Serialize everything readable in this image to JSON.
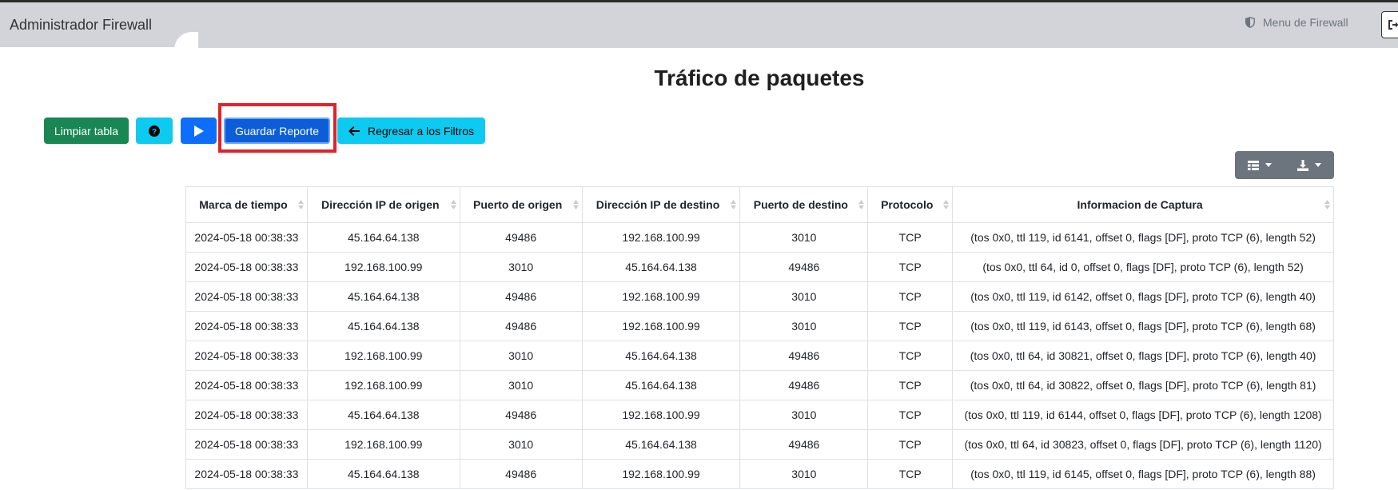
{
  "navbar": {
    "brand": "Administrador Firewall",
    "menu_label": "Menu de Firewall",
    "menu_icon": "shield-icon",
    "logout_icon": "logout-icon"
  },
  "page": {
    "title": "Tráfico de paquetes"
  },
  "toolbar": {
    "limpiar_label": "Limpiar tabla",
    "help_icon": "question-circle-icon",
    "play_icon": "play-icon",
    "guardar_label": "Guardar Reporte",
    "regresar_label": "Regresar a los Filtros",
    "regresar_icon": "arrow-left-icon"
  },
  "colors": {
    "success": "#198754",
    "info": "#0dcaf0",
    "primary": "#0d6efd",
    "highlight": "#e0232b",
    "secondary": "#6c757d"
  },
  "table": {
    "columns": [
      "Marca de tiempo",
      "Dirección IP de origen",
      "Puerto de origen",
      "Dirección IP de destino",
      "Puerto de destino",
      "Protocolo",
      "Informacion de Captura"
    ],
    "rows": [
      [
        "2024-05-18 00:38:33",
        "45.164.64.138",
        "49486",
        "192.168.100.99",
        "3010",
        "TCP",
        "(tos 0x0, ttl 119, id 6141, offset 0, flags [DF], proto TCP (6), length 52)"
      ],
      [
        "2024-05-18 00:38:33",
        "192.168.100.99",
        "3010",
        "45.164.64.138",
        "49486",
        "TCP",
        "(tos 0x0, ttl 64, id 0, offset 0, flags [DF], proto TCP (6), length 52)"
      ],
      [
        "2024-05-18 00:38:33",
        "45.164.64.138",
        "49486",
        "192.168.100.99",
        "3010",
        "TCP",
        "(tos 0x0, ttl 119, id 6142, offset 0, flags [DF], proto TCP (6), length 40)"
      ],
      [
        "2024-05-18 00:38:33",
        "45.164.64.138",
        "49486",
        "192.168.100.99",
        "3010",
        "TCP",
        "(tos 0x0, ttl 119, id 6143, offset 0, flags [DF], proto TCP (6), length 68)"
      ],
      [
        "2024-05-18 00:38:33",
        "192.168.100.99",
        "3010",
        "45.164.64.138",
        "49486",
        "TCP",
        "(tos 0x0, ttl 64, id 30821, offset 0, flags [DF], proto TCP (6), length 40)"
      ],
      [
        "2024-05-18 00:38:33",
        "192.168.100.99",
        "3010",
        "45.164.64.138",
        "49486",
        "TCP",
        "(tos 0x0, ttl 64, id 30822, offset 0, flags [DF], proto TCP (6), length 81)"
      ],
      [
        "2024-05-18 00:38:33",
        "45.164.64.138",
        "49486",
        "192.168.100.99",
        "3010",
        "TCP",
        "(tos 0x0, ttl 119, id 6144, offset 0, flags [DF], proto TCP (6), length 1208)"
      ],
      [
        "2024-05-18 00:38:33",
        "192.168.100.99",
        "3010",
        "45.164.64.138",
        "49486",
        "TCP",
        "(tos 0x0, ttl 64, id 30823, offset 0, flags [DF], proto TCP (6), length 1120)"
      ],
      [
        "2024-05-18 00:38:33",
        "45.164.64.138",
        "49486",
        "192.168.100.99",
        "3010",
        "TCP",
        "(tos 0x0, ttl 119, id 6145, offset 0, flags [DF], proto TCP (6), length 88)"
      ]
    ]
  }
}
